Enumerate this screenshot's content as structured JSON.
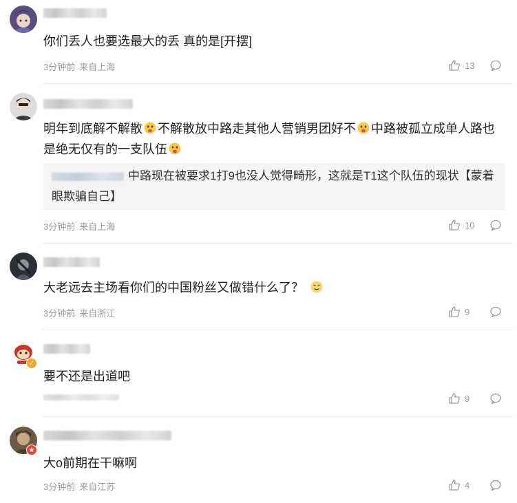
{
  "comments": [
    {
      "text": "你们丢人也要选最大的丢 真的是[开摆]",
      "time": "3分钟前",
      "location": "来自上海",
      "likes": "13"
    },
    {
      "text_part1": "明年到底解不解散",
      "text_part2": "不解散放中路走其他人营销男团好不",
      "text_part3": "中路被孤立成单人路也是绝无仅有的一支队伍",
      "reply_text": "中路现在被要求1打9也没人觉得畸形，这就是T1这个队伍的现状【蒙着眼欺骗自己】",
      "time": "3分钟前",
      "location": "来自上海",
      "likes": "10"
    },
    {
      "text": "大老远去主场看你们的中国粉丝又做错什么了？",
      "time": "3分钟前",
      "location": "来自浙江",
      "likes": "9"
    },
    {
      "text": "要不还是出道吧",
      "likes": "9"
    },
    {
      "text": "大o前期在干嘛啊",
      "time": "3分钟前",
      "location": "来自江苏",
      "likes": "4"
    }
  ],
  "icons": {
    "like": "thumbs-up-icon",
    "reply": "comment-bubble-icon"
  },
  "colors": {
    "muted": "#9a9a9a",
    "divider": "#ececec",
    "reply_bg": "#f5f5f5",
    "vip_badge": "#f5a623"
  }
}
